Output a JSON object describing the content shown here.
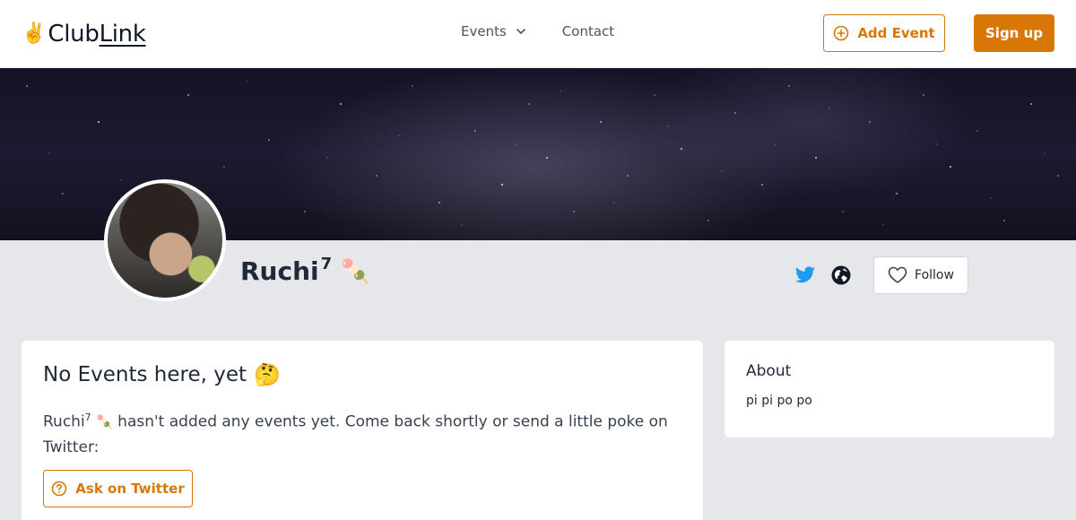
{
  "brand": {
    "emoji": "✌️",
    "name_part1": "Club",
    "name_part2": "Link"
  },
  "nav": {
    "events_label": "Events",
    "contact_label": "Contact"
  },
  "header_actions": {
    "add_event_label": "Add Event",
    "signup_label": "Sign up"
  },
  "profile": {
    "name": "Ruchi",
    "name_superscript": "7",
    "name_emoji": "🍡",
    "follow_label": "Follow"
  },
  "events_card": {
    "title": "No Events here, yet",
    "title_emoji": "🤔",
    "message_name": "Ruchi",
    "message_superscript": "7",
    "message_emoji": "🍡",
    "message_text": " hasn't added any events yet. Come back shortly or send a little poke on Twitter:",
    "ask_button_label": "Ask on Twitter"
  },
  "about_card": {
    "title": "About",
    "text": "pi pi po po"
  },
  "icons": {
    "chevron": "chevron-down-icon",
    "add": "plus-circle-icon",
    "twitter": "twitter-icon",
    "globe": "globe-icon",
    "heart": "heart-icon",
    "question": "question-circle-icon"
  },
  "colors": {
    "accent": "#d97706",
    "twitter": "#1d9bf0",
    "background": "#e5e7eb"
  }
}
